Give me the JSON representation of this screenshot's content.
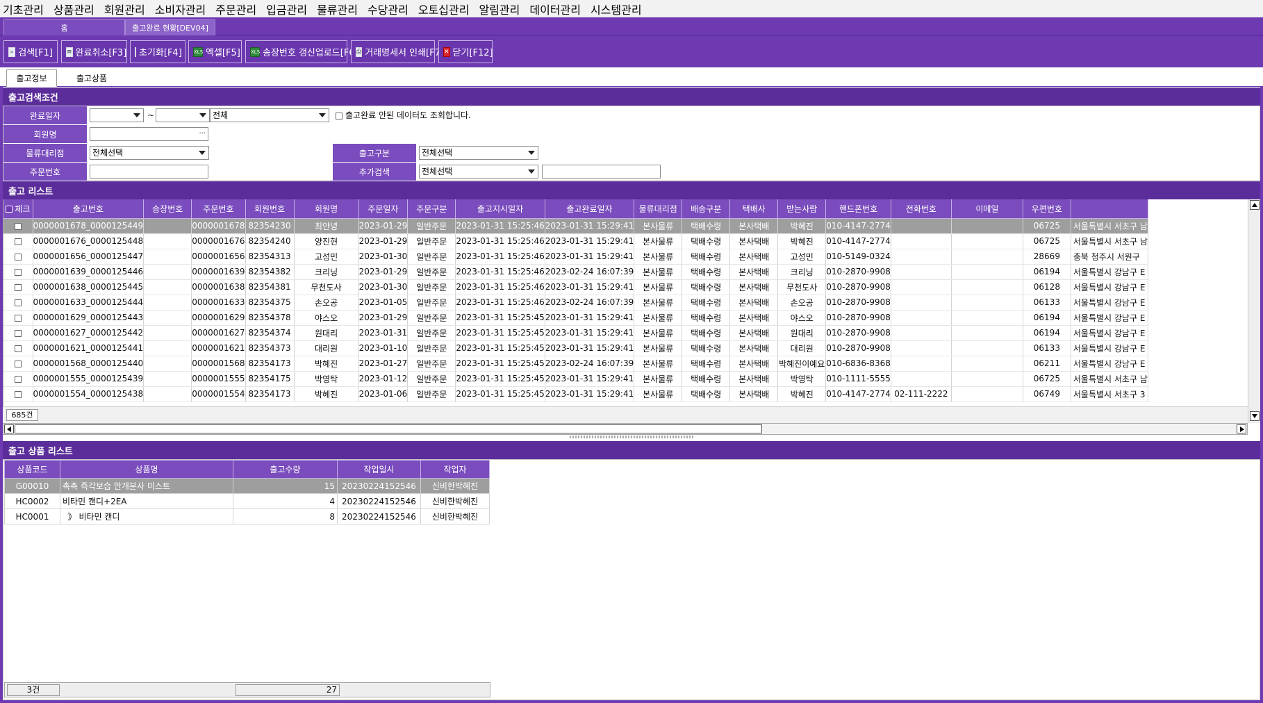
{
  "menu": [
    "기초관리",
    "상품관리",
    "회원관리",
    "소비자관리",
    "주문관리",
    "입금관리",
    "물류관리",
    "수당관리",
    "오토십관리",
    "알림관리",
    "데이터관리",
    "시스템관리"
  ],
  "tabs": {
    "home": "홈",
    "current": "출고완료 현황[DEV04]"
  },
  "toolbar": {
    "search": "검색[F1]",
    "cancel_complete": "완료취소[F3]",
    "reset": "초기화[F4]",
    "excel": "엑셀[F5]",
    "invoice_upload": "송장번호 갱신업로드[F6]",
    "print_statement": "거래명세서 인쇄[F7]",
    "close": "닫기[F12]"
  },
  "subtabs": {
    "info": "출고정보",
    "goods": "출고상품"
  },
  "search": {
    "header": "출고검색조건",
    "complete_date_label": "완료일자",
    "tilde": "~",
    "date_type_value": "전체",
    "incomplete_checkbox_label": "출고완료 안된 데이터도 조회합니다.",
    "member_name_label": "회원명",
    "ellipsis": "···",
    "logistics_agent_label": "물류대리점",
    "logistics_agent_value": "전체선택",
    "shipping_type_label": "출고구분",
    "shipping_type_value": "전체선택",
    "order_no_label": "주문번호",
    "extra_search_label": "추가검색",
    "extra_search_value": "전체선택"
  },
  "list": {
    "header": "출고 리스트",
    "columns": [
      "체크",
      "출고번호",
      "송장번호",
      "주문번호",
      "회원번호",
      "회원명",
      "주문일자",
      "주문구분",
      "출고지시일자",
      "출고완료일자",
      "물류대리점",
      "배송구분",
      "택배사",
      "받는사람",
      "핸드폰번호",
      "전화번호",
      "이메일",
      "우편번호",
      ""
    ],
    "rows": [
      {
        "ship_no": "0000001678_0000125449",
        "invoice": "",
        "order_no": "0000001678",
        "member_no": "82354230",
        "member_name": "최안녕",
        "order_date": "2023-01-29",
        "order_type": "일반주문",
        "ship_order_date": "2023-01-31 15:25:46",
        "ship_done_date": "2023-01-31 15:29:41",
        "agent": "본사물류",
        "delivery_type": "택배수령",
        "courier": "본사택배",
        "receiver": "박혜진",
        "mobile": "010-4147-2774",
        "phone": "",
        "email": "",
        "zip": "06725",
        "address": "서울특별시 서초구 남"
      },
      {
        "ship_no": "0000001676_0000125448",
        "invoice": "",
        "order_no": "0000001676",
        "member_no": "82354240",
        "member_name": "양진현",
        "order_date": "2023-01-29",
        "order_type": "일반주문",
        "ship_order_date": "2023-01-31 15:25:46",
        "ship_done_date": "2023-01-31 15:29:41",
        "agent": "본사물류",
        "delivery_type": "택배수령",
        "courier": "본사택배",
        "receiver": "박혜진",
        "mobile": "010-4147-2774",
        "phone": "",
        "email": "",
        "zip": "06725",
        "address": "서울특별시 서초구 남"
      },
      {
        "ship_no": "0000001656_0000125447",
        "invoice": "",
        "order_no": "0000001656",
        "member_no": "82354313",
        "member_name": "고성민",
        "order_date": "2023-01-30",
        "order_type": "일반주문",
        "ship_order_date": "2023-01-31 15:25:46",
        "ship_done_date": "2023-01-31 15:29:41",
        "agent": "본사물류",
        "delivery_type": "택배수령",
        "courier": "본사택배",
        "receiver": "고성민",
        "mobile": "010-5149-0324",
        "phone": "",
        "email": "",
        "zip": "28669",
        "address": "충북 청주시 서원구"
      },
      {
        "ship_no": "0000001639_0000125446",
        "invoice": "",
        "order_no": "0000001639",
        "member_no": "82354382",
        "member_name": "크리닝",
        "order_date": "2023-01-29",
        "order_type": "일반주문",
        "ship_order_date": "2023-01-31 15:25:46",
        "ship_done_date": "2023-02-24 16:07:39",
        "agent": "본사물류",
        "delivery_type": "택배수령",
        "courier": "본사택배",
        "receiver": "크리닝",
        "mobile": "010-2870-9908",
        "phone": "",
        "email": "",
        "zip": "06194",
        "address": "서울특별시 강남구 E"
      },
      {
        "ship_no": "0000001638_0000125445",
        "invoice": "",
        "order_no": "0000001638",
        "member_no": "82354381",
        "member_name": "무천도사",
        "order_date": "2023-01-30",
        "order_type": "일반주문",
        "ship_order_date": "2023-01-31 15:25:46",
        "ship_done_date": "2023-01-31 15:29:41",
        "agent": "본사물류",
        "delivery_type": "택배수령",
        "courier": "본사택배",
        "receiver": "무천도사",
        "mobile": "010-2870-9908",
        "phone": "",
        "email": "",
        "zip": "06128",
        "address": "서울특별시 강남구 E"
      },
      {
        "ship_no": "0000001633_0000125444",
        "invoice": "",
        "order_no": "0000001633",
        "member_no": "82354375",
        "member_name": "손오공",
        "order_date": "2023-01-05",
        "order_type": "일반주문",
        "ship_order_date": "2023-01-31 15:25:46",
        "ship_done_date": "2023-02-24 16:07:39",
        "agent": "본사물류",
        "delivery_type": "택배수령",
        "courier": "본사택배",
        "receiver": "손오공",
        "mobile": "010-2870-9908",
        "phone": "",
        "email": "",
        "zip": "06133",
        "address": "서울특별시 강남구 E"
      },
      {
        "ship_no": "0000001629_0000125443",
        "invoice": "",
        "order_no": "0000001629",
        "member_no": "82354378",
        "member_name": "야스오",
        "order_date": "2023-01-29",
        "order_type": "일반주문",
        "ship_order_date": "2023-01-31 15:25:45",
        "ship_done_date": "2023-01-31 15:29:41",
        "agent": "본사물류",
        "delivery_type": "택배수령",
        "courier": "본사택배",
        "receiver": "야스오",
        "mobile": "010-2870-9908",
        "phone": "",
        "email": "",
        "zip": "06194",
        "address": "서울특별시 강남구 E"
      },
      {
        "ship_no": "0000001627_0000125442",
        "invoice": "",
        "order_no": "0000001627",
        "member_no": "82354374",
        "member_name": "원대리",
        "order_date": "2023-01-31",
        "order_type": "일반주문",
        "ship_order_date": "2023-01-31 15:25:45",
        "ship_done_date": "2023-01-31 15:29:41",
        "agent": "본사물류",
        "delivery_type": "택배수령",
        "courier": "본사택배",
        "receiver": "원대리",
        "mobile": "010-2870-9908",
        "phone": "",
        "email": "",
        "zip": "06194",
        "address": "서울특별시 강남구 E"
      },
      {
        "ship_no": "0000001621_0000125441",
        "invoice": "",
        "order_no": "0000001621",
        "member_no": "82354373",
        "member_name": "대리원",
        "order_date": "2023-01-10",
        "order_type": "일반주문",
        "ship_order_date": "2023-01-31 15:25:45",
        "ship_done_date": "2023-01-31 15:29:41",
        "agent": "본사물류",
        "delivery_type": "택배수령",
        "courier": "본사택배",
        "receiver": "대리원",
        "mobile": "010-2870-9908",
        "phone": "",
        "email": "",
        "zip": "06133",
        "address": "서울특별시 강남구 E"
      },
      {
        "ship_no": "0000001568_0000125440",
        "invoice": "",
        "order_no": "0000001568",
        "member_no": "82354173",
        "member_name": "박혜진",
        "order_date": "2023-01-27",
        "order_type": "일반주문",
        "ship_order_date": "2023-01-31 15:25:45",
        "ship_done_date": "2023-02-24 16:07:39",
        "agent": "본사물류",
        "delivery_type": "택배수령",
        "courier": "본사택배",
        "receiver": "박혜진이예요",
        "mobile": "010-6836-8368",
        "phone": "",
        "email": "",
        "zip": "06211",
        "address": "서울특별시 강남구 E"
      },
      {
        "ship_no": "0000001555_0000125439",
        "invoice": "",
        "order_no": "0000001555",
        "member_no": "82354175",
        "member_name": "박영탁",
        "order_date": "2023-01-12",
        "order_type": "일반주문",
        "ship_order_date": "2023-01-31 15:25:45",
        "ship_done_date": "2023-01-31 15:29:41",
        "agent": "본사물류",
        "delivery_type": "택배수령",
        "courier": "본사택배",
        "receiver": "박영탁",
        "mobile": "010-1111-5555",
        "phone": "",
        "email": "",
        "zip": "06725",
        "address": "서울특별시 서초구 남"
      },
      {
        "ship_no": "0000001554_0000125438",
        "invoice": "",
        "order_no": "0000001554",
        "member_no": "82354173",
        "member_name": "박혜진",
        "order_date": "2023-01-06",
        "order_type": "일반주문",
        "ship_order_date": "2023-01-31 15:25:45",
        "ship_done_date": "2023-01-31 15:29:41",
        "agent": "본사물류",
        "delivery_type": "택배수령",
        "courier": "본사택배",
        "receiver": "박혜진",
        "mobile": "010-4147-2774",
        "phone": "02-111-2222",
        "email": "",
        "zip": "06749",
        "address": "서울특별시 서초구 3"
      }
    ],
    "count": "685건"
  },
  "goods": {
    "header": "출고 상품 리스트",
    "columns": [
      "상품코드",
      "상품명",
      "출고수량",
      "작업일시",
      "작업자"
    ],
    "rows": [
      {
        "code": "G00010",
        "name": "촉촉 즉각보습 안개분사 미스트",
        "qty": "15",
        "work_date": "20230224152546",
        "worker": "신비한박혜진"
      },
      {
        "code": "HC0002",
        "name": "비타민 캔디+2EA",
        "qty": "4",
        "work_date": "20230224152546",
        "worker": "신비한박혜진"
      },
      {
        "code": "HC0001",
        "name": "  》 비타민 캔디",
        "qty": "8",
        "work_date": "20230224152546",
        "worker": "신비한박혜진"
      }
    ],
    "count": "3건",
    "qty_total": "27"
  }
}
